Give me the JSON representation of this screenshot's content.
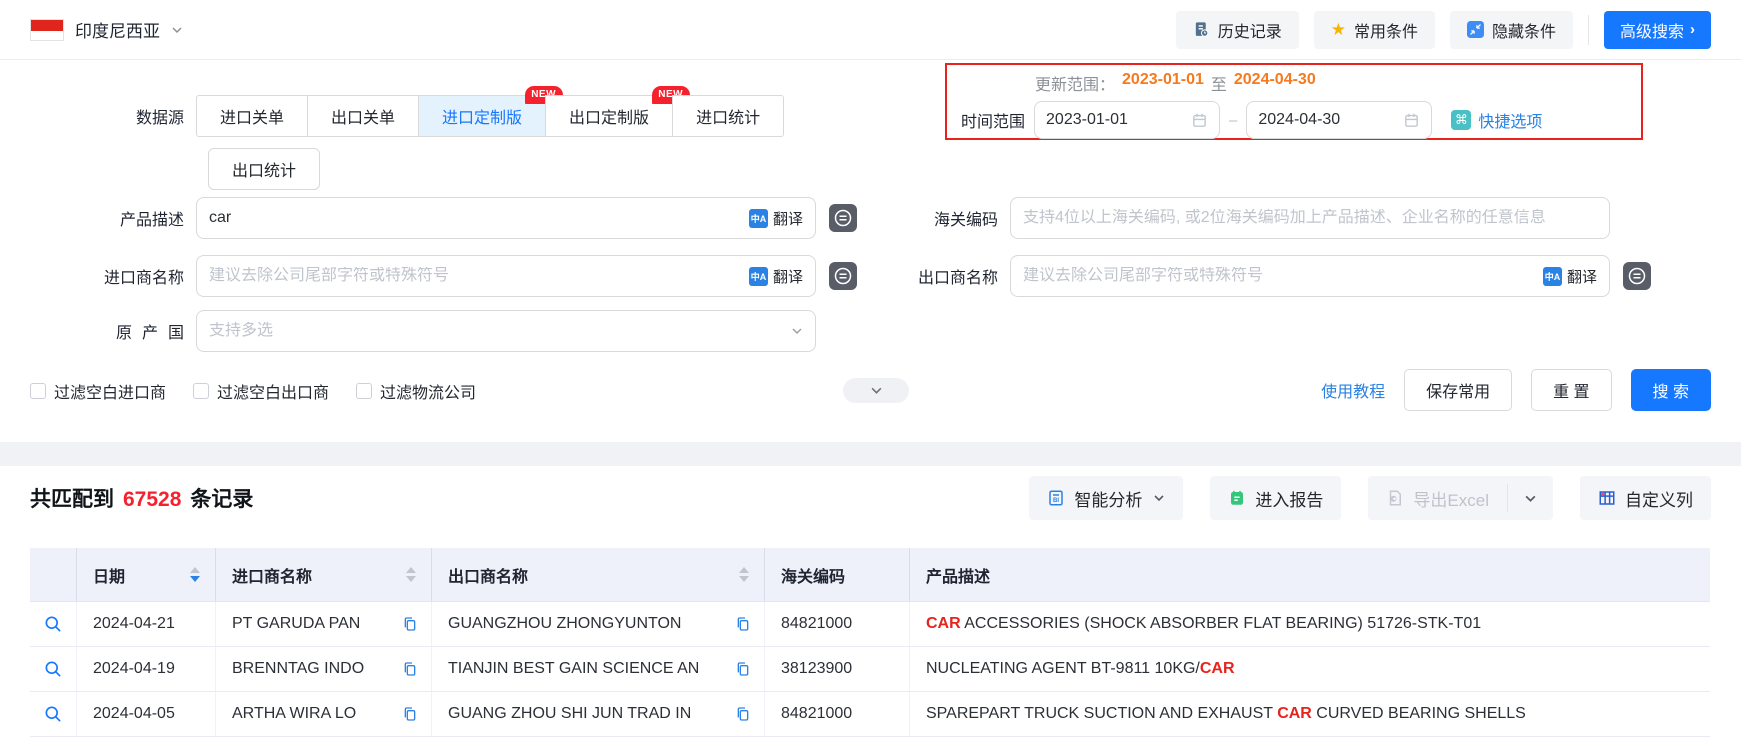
{
  "topbar": {
    "country": "印度尼西亚",
    "history": "历史记录",
    "favorites": "常用条件",
    "hide_conditions": "隐藏条件",
    "advanced_search": "高级搜索"
  },
  "search": {
    "data_source_label": "数据源",
    "tabs": [
      {
        "label": "进口关单"
      },
      {
        "label": "出口关单"
      },
      {
        "label": "进口定制版",
        "badge": "NEW"
      },
      {
        "label": "出口定制版",
        "badge": "NEW"
      },
      {
        "label": "进口统计"
      },
      {
        "label": "出口统计"
      }
    ],
    "update_range": {
      "label": "更新范围：",
      "start": "2023-01-01",
      "to": "至",
      "end": "2024-04-30"
    },
    "time_range": {
      "label": "时间范围",
      "start": "2023-01-01",
      "end": "2024-04-30",
      "quick": "快捷选项"
    },
    "fields": {
      "product": {
        "label": "产品描述",
        "value": "car",
        "translate": "翻译"
      },
      "hs": {
        "label": "海关编码",
        "placeholder": "支持4位以上海关编码, 或2位海关编码加上产品描述、企业名称的任意信息"
      },
      "importer": {
        "label": "进口商名称",
        "placeholder": "建议去除公司尾部字符或特殊符号",
        "translate": "翻译"
      },
      "exporter": {
        "label": "出口商名称",
        "placeholder": "建议去除公司尾部字符或特殊符号",
        "translate": "翻译"
      },
      "origin": {
        "label": "原产国",
        "placeholder": "支持多选"
      }
    },
    "filters": [
      "过滤空白进口商",
      "过滤空白出口商",
      "过滤物流公司"
    ],
    "actions": {
      "tutorial": "使用教程",
      "save": "保存常用",
      "reset": "重 置",
      "search": "搜 索"
    }
  },
  "results": {
    "summary": {
      "prefix": "共匹配到",
      "count": "67528",
      "suffix": "条记录"
    },
    "toolbar": {
      "analysis": "智能分析",
      "report": "进入报告",
      "export": "导出Excel",
      "columns": "自定义列"
    }
  },
  "table": {
    "headers": {
      "date": "日期",
      "importer": "进口商名称",
      "exporter": "出口商名称",
      "hs": "海关编码",
      "desc": "产品描述"
    },
    "rows": [
      {
        "date": "2024-04-21",
        "importer": "PT GARUDA PAN",
        "exporter": "GUANGZHOU ZHONGYUNTON",
        "hs": "84821000",
        "desc_parts": [
          {
            "t": "CAR",
            "hl": true
          },
          {
            "t": " ACCESSORIES (SHOCK ABSORBER FLAT BEARING) 51726-STK-T01",
            "hl": false
          }
        ]
      },
      {
        "date": "2024-04-19",
        "importer": "BRENNTAG INDO",
        "exporter": "TIANJIN BEST GAIN SCIENCE AN",
        "hs": "38123900",
        "desc_parts": [
          {
            "t": "NUCLEATING AGENT BT-9811 10KG/",
            "hl": false
          },
          {
            "t": "CAR",
            "hl": true
          }
        ]
      },
      {
        "date": "2024-04-05",
        "importer": "ARTHA WIRA LO",
        "exporter": "GUANG ZHOU SHI JUN TRAD IN",
        "hs": "84821000",
        "desc_parts": [
          {
            "t": "SPAREPART TRUCK SUCTION AND EXHAUST ",
            "hl": false
          },
          {
            "t": "CAR",
            "hl": true
          },
          {
            "t": " CURVED BEARING SHELLS",
            "hl": false
          }
        ]
      }
    ]
  },
  "colors": {
    "accent": "#1677ff",
    "highlight_red": "#e8231d",
    "count_red": "#f5222d",
    "orange": "#f57a1f",
    "link_blue": "#2a82e4"
  }
}
